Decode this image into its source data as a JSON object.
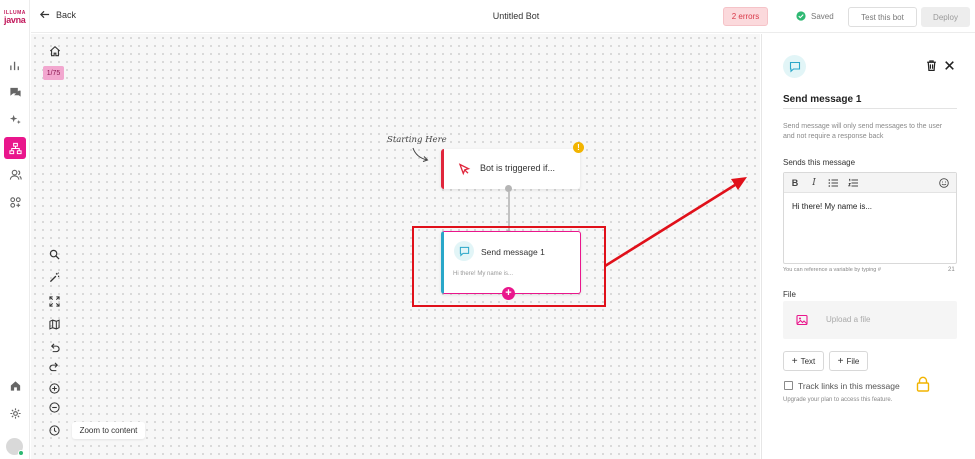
{
  "brand": {
    "logo_top": "ILLUMA",
    "logo_word": "javna"
  },
  "header": {
    "back_label": "Back",
    "title": "Untitled Bot",
    "errors_label": "2 errors",
    "saved_label": "Saved",
    "test_label": "Test this bot",
    "deploy_label": "Deploy"
  },
  "canvas": {
    "counter": "1/75",
    "zoom_tooltip": "Zoom to content",
    "start_label": "Starting Here",
    "trigger_node": {
      "label": "Bot is triggered if...",
      "warning": "!"
    },
    "message_node": {
      "label": "Send message 1",
      "preview": "Hi there! My name is..."
    },
    "add_symbol": "+"
  },
  "panel": {
    "title": "Send message 1",
    "description": "Send message will only send messages to the user and not require a response back",
    "sends_label": "Sends this message",
    "toolbar": {
      "bold": "B",
      "italic": "I"
    },
    "message_text": "Hi there! My name is...",
    "hint": "You can reference a variable by typing #",
    "char_count": "21",
    "file_label": "File",
    "upload_label": "Upload a file",
    "add_text_label": "Text",
    "add_file_label": "File",
    "plus": "+",
    "track_label": "Track links in this message",
    "upgrade_note": "Upgrade your plan to access this feature."
  },
  "colors": {
    "accent": "#e9168c",
    "error": "#e0263c",
    "annotation_red": "#e0101a",
    "teal": "#2aa7c9",
    "warning": "#f2b400"
  }
}
